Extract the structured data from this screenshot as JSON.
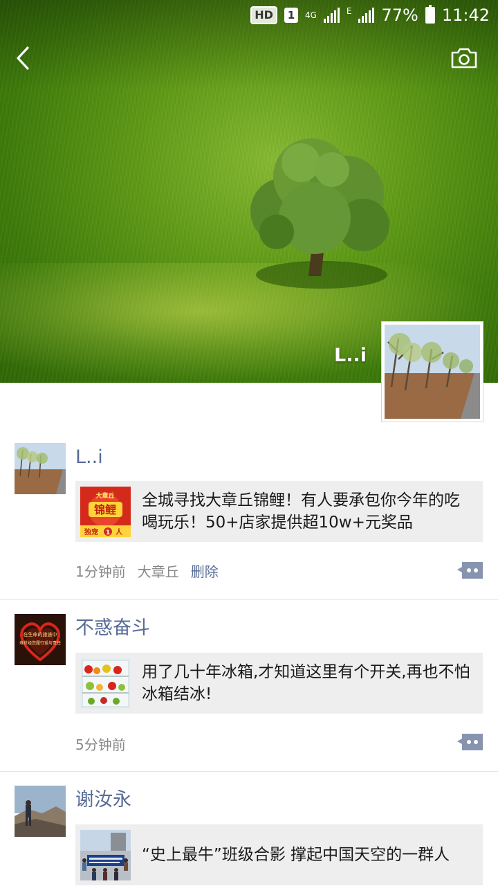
{
  "status_bar": {
    "hd": "HD",
    "sim": "1",
    "network": "4G",
    "network2": "E",
    "battery": "77%",
    "time": "11:42"
  },
  "nav": {
    "back_icon": "chevron-left-icon",
    "camera_icon": "camera-icon"
  },
  "profile": {
    "name": "L..i"
  },
  "posts": [
    {
      "author": "L..i",
      "share_text": "全城寻找大章丘锦鲤！有人要承包你今年的吃喝玩乐！50+店家提供超10w+元奖品",
      "thumb_text": {
        "top": "大章丘",
        "main": "锦鲤",
        "bottom": "独宠",
        "bottom_num": "1",
        "bottom_unit": "人"
      },
      "time": "1分钟前",
      "location": "大章丘",
      "delete": "删除"
    },
    {
      "author": "不惑奋斗",
      "avatar_text": {
        "line1": "在生命的旅途中",
        "line2": "寿世经您履行爱与责任"
      },
      "share_text": "用了几十年冰箱,才知道这里有个开关,再也不怕冰箱结冰!",
      "time": "5分钟前"
    },
    {
      "author": "谢汝永",
      "share_text": "“史上最牛”班级合影 撑起中国天空的一群人"
    }
  ],
  "colors": {
    "link": "#576b95",
    "card_bg": "#eeeeee",
    "meta": "#888888"
  }
}
